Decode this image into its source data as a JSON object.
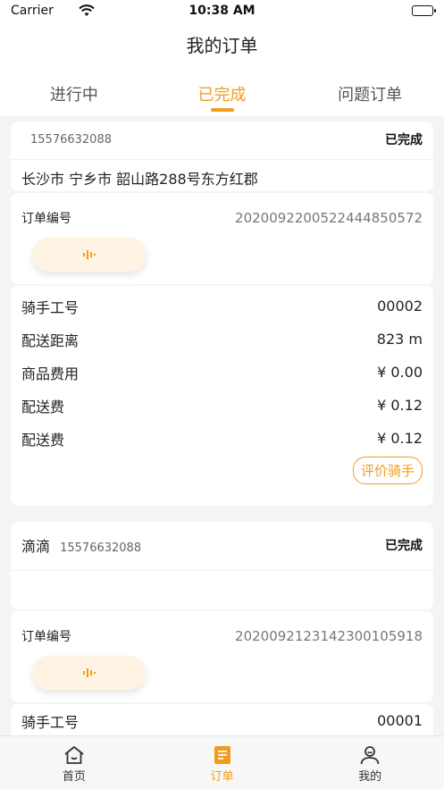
{
  "status_bar": {
    "carrier": "Carrier",
    "time": "10:38 AM"
  },
  "header": {
    "title": "我的订单"
  },
  "tabs": [
    {
      "label": "进行中"
    },
    {
      "label": "已完成"
    },
    {
      "label": "问题订单"
    }
  ],
  "orders": [
    {
      "name": "",
      "phone": "15576632088",
      "status": "已完成",
      "address": "长沙市 宁乡市 韶山路288号东方红郡",
      "order_no_label": "订单编号",
      "order_no": "2020092200522444850572",
      "details": [
        {
          "label": "骑手工号",
          "value": "00002"
        },
        {
          "label": "配送距离",
          "value": "823 m"
        },
        {
          "label": "商品费用",
          "value": "¥ 0.00"
        },
        {
          "label": "配送费",
          "value": "¥ 0.12"
        },
        {
          "label": "配送费",
          "value": "¥ 0.12"
        }
      ],
      "rate_label": "评价骑手"
    },
    {
      "name": "滴滴",
      "phone": "15576632088",
      "status": "已完成",
      "address": "",
      "order_no_label": "订单编号",
      "order_no": "2020092123142300105918",
      "details": [
        {
          "label": "骑手工号",
          "value": "00001"
        }
      ]
    }
  ],
  "tabbar": [
    {
      "label": "首页",
      "icon": "home-icon"
    },
    {
      "label": "订单",
      "icon": "order-doc-icon"
    },
    {
      "label": "我的",
      "icon": "user-icon"
    }
  ],
  "colors": {
    "accent": "#f39c1b",
    "background": "#f4f4f4",
    "card": "#ffffff"
  }
}
